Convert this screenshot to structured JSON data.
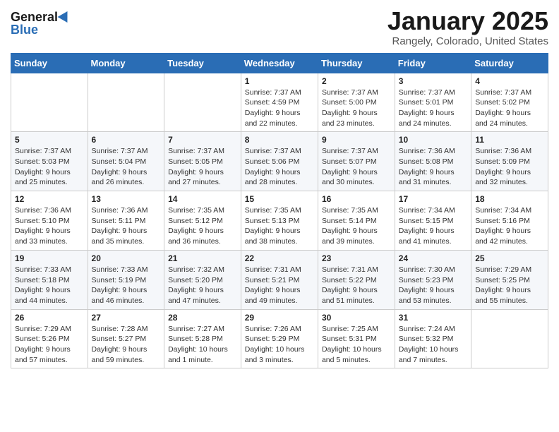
{
  "header": {
    "logo_general": "General",
    "logo_blue": "Blue",
    "title": "January 2025",
    "location": "Rangely, Colorado, United States"
  },
  "calendar": {
    "days_of_week": [
      "Sunday",
      "Monday",
      "Tuesday",
      "Wednesday",
      "Thursday",
      "Friday",
      "Saturday"
    ],
    "weeks": [
      [
        {
          "day": "",
          "content": ""
        },
        {
          "day": "",
          "content": ""
        },
        {
          "day": "",
          "content": ""
        },
        {
          "day": "1",
          "content": "Sunrise: 7:37 AM\nSunset: 4:59 PM\nDaylight: 9 hours and 22 minutes."
        },
        {
          "day": "2",
          "content": "Sunrise: 7:37 AM\nSunset: 5:00 PM\nDaylight: 9 hours and 23 minutes."
        },
        {
          "day": "3",
          "content": "Sunrise: 7:37 AM\nSunset: 5:01 PM\nDaylight: 9 hours and 24 minutes."
        },
        {
          "day": "4",
          "content": "Sunrise: 7:37 AM\nSunset: 5:02 PM\nDaylight: 9 hours and 24 minutes."
        }
      ],
      [
        {
          "day": "5",
          "content": "Sunrise: 7:37 AM\nSunset: 5:03 PM\nDaylight: 9 hours and 25 minutes."
        },
        {
          "day": "6",
          "content": "Sunrise: 7:37 AM\nSunset: 5:04 PM\nDaylight: 9 hours and 26 minutes."
        },
        {
          "day": "7",
          "content": "Sunrise: 7:37 AM\nSunset: 5:05 PM\nDaylight: 9 hours and 27 minutes."
        },
        {
          "day": "8",
          "content": "Sunrise: 7:37 AM\nSunset: 5:06 PM\nDaylight: 9 hours and 28 minutes."
        },
        {
          "day": "9",
          "content": "Sunrise: 7:37 AM\nSunset: 5:07 PM\nDaylight: 9 hours and 30 minutes."
        },
        {
          "day": "10",
          "content": "Sunrise: 7:36 AM\nSunset: 5:08 PM\nDaylight: 9 hours and 31 minutes."
        },
        {
          "day": "11",
          "content": "Sunrise: 7:36 AM\nSunset: 5:09 PM\nDaylight: 9 hours and 32 minutes."
        }
      ],
      [
        {
          "day": "12",
          "content": "Sunrise: 7:36 AM\nSunset: 5:10 PM\nDaylight: 9 hours and 33 minutes."
        },
        {
          "day": "13",
          "content": "Sunrise: 7:36 AM\nSunset: 5:11 PM\nDaylight: 9 hours and 35 minutes."
        },
        {
          "day": "14",
          "content": "Sunrise: 7:35 AM\nSunset: 5:12 PM\nDaylight: 9 hours and 36 minutes."
        },
        {
          "day": "15",
          "content": "Sunrise: 7:35 AM\nSunset: 5:13 PM\nDaylight: 9 hours and 38 minutes."
        },
        {
          "day": "16",
          "content": "Sunrise: 7:35 AM\nSunset: 5:14 PM\nDaylight: 9 hours and 39 minutes."
        },
        {
          "day": "17",
          "content": "Sunrise: 7:34 AM\nSunset: 5:15 PM\nDaylight: 9 hours and 41 minutes."
        },
        {
          "day": "18",
          "content": "Sunrise: 7:34 AM\nSunset: 5:16 PM\nDaylight: 9 hours and 42 minutes."
        }
      ],
      [
        {
          "day": "19",
          "content": "Sunrise: 7:33 AM\nSunset: 5:18 PM\nDaylight: 9 hours and 44 minutes."
        },
        {
          "day": "20",
          "content": "Sunrise: 7:33 AM\nSunset: 5:19 PM\nDaylight: 9 hours and 46 minutes."
        },
        {
          "day": "21",
          "content": "Sunrise: 7:32 AM\nSunset: 5:20 PM\nDaylight: 9 hours and 47 minutes."
        },
        {
          "day": "22",
          "content": "Sunrise: 7:31 AM\nSunset: 5:21 PM\nDaylight: 9 hours and 49 minutes."
        },
        {
          "day": "23",
          "content": "Sunrise: 7:31 AM\nSunset: 5:22 PM\nDaylight: 9 hours and 51 minutes."
        },
        {
          "day": "24",
          "content": "Sunrise: 7:30 AM\nSunset: 5:23 PM\nDaylight: 9 hours and 53 minutes."
        },
        {
          "day": "25",
          "content": "Sunrise: 7:29 AM\nSunset: 5:25 PM\nDaylight: 9 hours and 55 minutes."
        }
      ],
      [
        {
          "day": "26",
          "content": "Sunrise: 7:29 AM\nSunset: 5:26 PM\nDaylight: 9 hours and 57 minutes."
        },
        {
          "day": "27",
          "content": "Sunrise: 7:28 AM\nSunset: 5:27 PM\nDaylight: 9 hours and 59 minutes."
        },
        {
          "day": "28",
          "content": "Sunrise: 7:27 AM\nSunset: 5:28 PM\nDaylight: 10 hours and 1 minute."
        },
        {
          "day": "29",
          "content": "Sunrise: 7:26 AM\nSunset: 5:29 PM\nDaylight: 10 hours and 3 minutes."
        },
        {
          "day": "30",
          "content": "Sunrise: 7:25 AM\nSunset: 5:31 PM\nDaylight: 10 hours and 5 minutes."
        },
        {
          "day": "31",
          "content": "Sunrise: 7:24 AM\nSunset: 5:32 PM\nDaylight: 10 hours and 7 minutes."
        },
        {
          "day": "",
          "content": ""
        }
      ]
    ]
  }
}
